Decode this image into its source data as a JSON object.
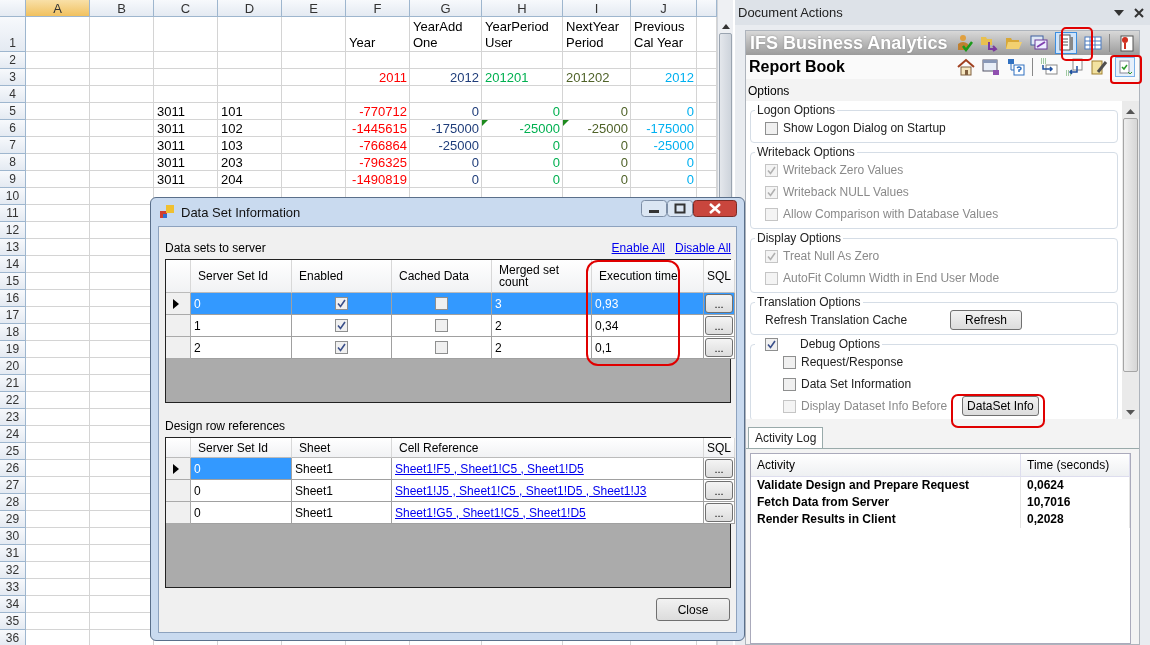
{
  "sheet": {
    "columns": [
      {
        "letter": "A",
        "selected": true
      },
      {
        "letter": "B",
        "selected": false
      },
      {
        "letter": "C",
        "selected": false
      },
      {
        "letter": "D",
        "selected": false
      },
      {
        "letter": "E",
        "selected": false
      },
      {
        "letter": "F",
        "selected": false,
        "color": "#ff0000"
      },
      {
        "letter": "G",
        "selected": false,
        "color": "#1f3d7a"
      },
      {
        "letter": "H",
        "selected": false,
        "color": "#00b050"
      },
      {
        "letter": "I",
        "selected": false,
        "color": "#4f6228"
      },
      {
        "letter": "J",
        "selected": false,
        "color": "#00b0f0"
      }
    ],
    "rows": [
      {
        "number": "1",
        "kind": "header",
        "cells": [
          {},
          {},
          {},
          {},
          {},
          {
            "text": "Year",
            "kind": "text"
          },
          {
            "text": "YearAdd One",
            "kind": "text"
          },
          {
            "text": "YearPeriod User",
            "kind": "text"
          },
          {
            "text": "NextYear Period",
            "kind": "text"
          },
          {
            "text": "Previous Cal Year",
            "kind": "text"
          }
        ]
      },
      {
        "number": "2"
      },
      {
        "number": "3",
        "kind": "values",
        "cells": [
          {},
          {},
          {},
          {},
          {},
          {
            "text": "2011",
            "kind": "number"
          },
          {
            "text": "2012",
            "kind": "number"
          },
          {
            "text": "201201",
            "kind": "text"
          },
          {
            "text": "201202",
            "kind": "text"
          },
          {
            "text": "2012",
            "kind": "number"
          }
        ]
      },
      {
        "number": "4"
      },
      {
        "number": "5",
        "kind": "values",
        "cells": [
          {},
          {},
          {
            "text": "3011",
            "kind": "text"
          },
          {
            "text": "101",
            "kind": "text"
          },
          {},
          {
            "text": "-770712",
            "kind": "number"
          },
          {
            "text": "0",
            "kind": "number"
          },
          {
            "text": "0",
            "kind": "number"
          },
          {
            "text": "0",
            "kind": "number"
          },
          {
            "text": "0",
            "kind": "number"
          }
        ]
      },
      {
        "number": "6",
        "kind": "values",
        "cells": [
          {},
          {},
          {
            "text": "3011",
            "kind": "text"
          },
          {
            "text": "102",
            "kind": "text"
          },
          {},
          {
            "text": "-1445615",
            "kind": "number"
          },
          {
            "text": "-175000",
            "kind": "number"
          },
          {
            "text": "-25000",
            "kind": "number",
            "flagged": true
          },
          {
            "text": "-25000",
            "kind": "number",
            "flagged": true
          },
          {
            "text": "-175000",
            "kind": "number"
          }
        ]
      },
      {
        "number": "7",
        "kind": "values",
        "cells": [
          {},
          {},
          {
            "text": "3011",
            "kind": "text"
          },
          {
            "text": "103",
            "kind": "text"
          },
          {},
          {
            "text": "-766864",
            "kind": "number"
          },
          {
            "text": "-25000",
            "kind": "number"
          },
          {
            "text": "0",
            "kind": "number"
          },
          {
            "text": "0",
            "kind": "number"
          },
          {
            "text": "-25000",
            "kind": "number"
          }
        ]
      },
      {
        "number": "8",
        "kind": "values",
        "cells": [
          {},
          {},
          {
            "text": "3011",
            "kind": "text"
          },
          {
            "text": "203",
            "kind": "text"
          },
          {},
          {
            "text": "-796325",
            "kind": "number"
          },
          {
            "text": "0",
            "kind": "number"
          },
          {
            "text": "0",
            "kind": "number"
          },
          {
            "text": "0",
            "kind": "number"
          },
          {
            "text": "0",
            "kind": "number"
          }
        ]
      },
      {
        "number": "9",
        "kind": "values",
        "cells": [
          {},
          {},
          {
            "text": "3011",
            "kind": "text"
          },
          {
            "text": "204",
            "kind": "text"
          },
          {},
          {
            "text": "-1490819",
            "kind": "number"
          },
          {
            "text": "0",
            "kind": "number"
          },
          {
            "text": "0",
            "kind": "number"
          },
          {
            "text": "0",
            "kind": "number"
          },
          {
            "text": "0",
            "kind": "number"
          }
        ]
      },
      {
        "number": "10"
      },
      {
        "number": "11"
      },
      {
        "number": "12"
      },
      {
        "number": "13"
      },
      {
        "number": "14"
      },
      {
        "number": "15"
      },
      {
        "number": "16"
      },
      {
        "number": "17"
      },
      {
        "number": "18"
      },
      {
        "number": "19"
      },
      {
        "number": "20"
      },
      {
        "number": "21"
      },
      {
        "number": "22"
      },
      {
        "number": "23"
      },
      {
        "number": "24"
      },
      {
        "number": "25"
      },
      {
        "number": "26"
      },
      {
        "number": "27"
      },
      {
        "number": "28"
      },
      {
        "number": "29"
      },
      {
        "number": "30"
      },
      {
        "number": "31"
      },
      {
        "number": "32"
      },
      {
        "number": "33"
      },
      {
        "number": "34"
      },
      {
        "number": "35"
      },
      {
        "number": "36"
      }
    ]
  },
  "dialog": {
    "title": "Data Set Information",
    "data_sets": {
      "label": "Data sets to server",
      "links": [
        "Enable All",
        "Disable All"
      ],
      "full_row_selection": true,
      "columns": [
        "Server Set Id",
        "Enabled",
        "Cached Data",
        "Merged set count",
        "Execution time",
        "SQL"
      ],
      "rows": [
        {
          "id": "0",
          "enabled": true,
          "cached": false,
          "merged": "3",
          "execution_time": "0,93",
          "sql": "...",
          "selected": true
        },
        {
          "id": "1",
          "enabled": true,
          "cached": false,
          "merged": "2",
          "execution_time": "0,34",
          "sql": "...",
          "selected": false
        },
        {
          "id": "2",
          "enabled": true,
          "cached": false,
          "merged": "2",
          "execution_time": "0,1",
          "sql": "...",
          "selected": false
        }
      ]
    },
    "references": {
      "label": "Design row references",
      "full_row_selection": false,
      "columns": [
        "Server Set Id",
        "Sheet",
        "Cell Reference",
        "SQL"
      ],
      "rows": [
        {
          "id": "0",
          "sheet": "Sheet1",
          "cell_reference": "Sheet1!F5 , Sheet1!C5 , Sheet1!D5",
          "sql": "...",
          "selected": true
        },
        {
          "id": "0",
          "sheet": "Sheet1",
          "cell_reference": "Sheet1!J5 , Sheet1!C5 , Sheet1!D5 , Sheet1!J3",
          "sql": "...",
          "selected": false
        },
        {
          "id": "0",
          "sheet": "Sheet1",
          "cell_reference": "Sheet1!G5 , Sheet1!C5 , Sheet1!D5",
          "sql": "...",
          "selected": false
        }
      ]
    },
    "close_button": "Close"
  },
  "task_pane": {
    "title": "Document Actions",
    "header": "IFS Business Analytics",
    "subheader": "Report Book",
    "section": "Options",
    "groups": [
      {
        "title": "Logon Options",
        "kind": "plain",
        "items": [
          {
            "kind": "checkbox",
            "label": "Show Logon Dialog on Startup",
            "checked": false,
            "disabled": false
          }
        ]
      },
      {
        "title": "Writeback Options",
        "kind": "plain",
        "items": [
          {
            "kind": "checkbox",
            "label": "Writeback Zero Values",
            "checked": true,
            "disabled": true
          },
          {
            "kind": "checkbox",
            "label": "Writeback NULL Values",
            "checked": true,
            "disabled": true
          },
          {
            "kind": "checkbox",
            "label": "Allow Comparison with Database Values",
            "checked": false,
            "disabled": true
          }
        ]
      },
      {
        "title": "Display Options",
        "kind": "plain",
        "items": [
          {
            "kind": "checkbox",
            "label": "Treat Null As Zero",
            "checked": true,
            "disabled": true
          },
          {
            "kind": "checkbox",
            "label": "AutoFit Column Width in End User Mode",
            "checked": false,
            "disabled": true
          }
        ]
      },
      {
        "title": "Translation Options",
        "kind": "plain",
        "items": [
          {
            "kind": "action",
            "label": "Refresh Translation Cache",
            "button": "Refresh"
          }
        ]
      },
      {
        "title": "Debug Options",
        "kind": "checkable",
        "checked": true,
        "items": [
          {
            "kind": "checkbox",
            "label": "Request/Response",
            "checked": false,
            "disabled": false
          },
          {
            "kind": "checkbox",
            "label": "Data Set Information",
            "checked": false,
            "disabled": false
          },
          {
            "kind": "checkbox",
            "label": "Display Dataset Info Before",
            "checked": false,
            "disabled": true,
            "button": "DataSet Info"
          }
        ]
      }
    ],
    "activity_log": {
      "tabs": [
        {
          "label": "Activity Log",
          "selected": true
        }
      ],
      "columns": [
        "Activity",
        "Time (seconds)"
      ],
      "rows": [
        {
          "activity": "Validate Design and Prepare Request",
          "time": "0,0624"
        },
        {
          "activity": "Fetch Data from Server",
          "time": "10,7016"
        },
        {
          "activity": "Render Results in Client",
          "time": "0,2028"
        }
      ]
    }
  }
}
